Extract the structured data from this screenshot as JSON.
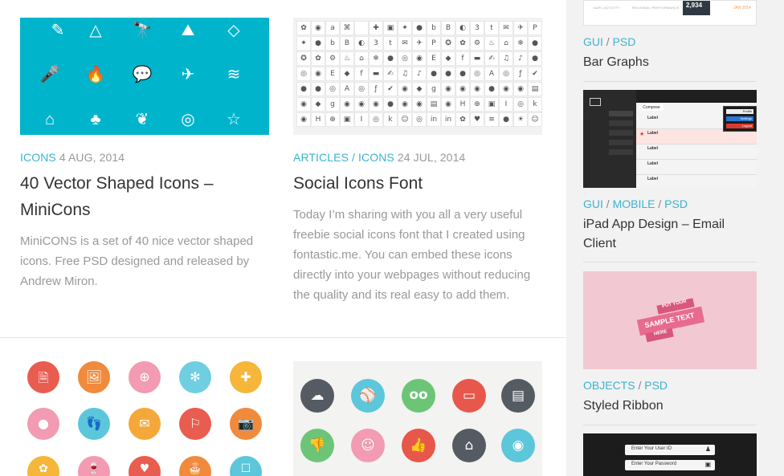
{
  "posts": [
    {
      "categories": [
        "ICONS"
      ],
      "date": "4 AUG, 2014",
      "title": "40 Vector Shaped Icons – MiniCons",
      "excerpt": "MiniCONS is a set of 40 nice vector shaped icons. Free PSD designed and released by Andrew Miron."
    },
    {
      "categories": [
        "ARTICLES",
        "ICONS"
      ],
      "date": "24 JUL, 2014",
      "title": "Social Icons Font",
      "excerpt": "Today I’m sharing with you all a very useful freebie social icons font that I created using fontastic.me. You can embed these icons directly into your webpages without reducing the quality and its real easy to add them."
    }
  ],
  "minicons": [
    "✎",
    "△",
    "🔭",
    "⛰",
    "◇",
    "🎤",
    "🔥",
    "💬",
    "✈",
    "≋",
    "⌂",
    "♣",
    "❦",
    "◎",
    "☆"
  ],
  "social_glyphs": [
    "✿",
    "◉",
    "a",
    "⌘",
    "",
    "✚",
    "▣",
    "✦",
    "●",
    "b",
    "B",
    "◐",
    "3",
    "t",
    "✉",
    "✈",
    "P",
    "✪",
    "✿",
    "⚙",
    "♨",
    "⌂",
    "❄",
    "●",
    "◎",
    "◉",
    "E",
    "◆",
    "f",
    "▬",
    "✍",
    "♫",
    "♪",
    "●",
    "●",
    "●",
    "◎",
    "A",
    "◎",
    "ƒ",
    "✔",
    "◉",
    "◆",
    "g",
    "◉",
    "◉",
    "◉",
    "●",
    "◉",
    "◉",
    "▤",
    "◉",
    "H",
    "⊕",
    "▣",
    "I",
    "◎",
    "k",
    "☺",
    "◎",
    "in",
    "in",
    "✿",
    "♥",
    "≡",
    "●",
    "☀",
    "☺"
  ],
  "flat_icons_row1": [
    "🗎",
    "🖼",
    "⊕",
    "✻",
    "✚"
  ],
  "flat_icons_row2": [
    "●",
    "👣",
    "✉",
    "⚐",
    "📷"
  ],
  "flat_icons_row3": [
    "✿",
    "🍷",
    "♥",
    "🎂",
    "☐"
  ],
  "flat2_row1": [
    "☁",
    "⚾",
    "oo",
    "▭",
    "▤"
  ],
  "flat2_row2": [
    "👎",
    "☺",
    "👍",
    "⌂",
    "◉"
  ],
  "sidebar": {
    "top_card": {
      "label_a": "AAPL ACTIVITY",
      "label_b": "REGIONAL PERFORMANCE",
      "stat": "2,934",
      "date": "JAN 2014"
    },
    "items": [
      {
        "categories": [
          "GUI",
          "PSD"
        ],
        "title": "Bar Graphs"
      },
      {
        "categories": [
          "GUI",
          "MOBILE",
          "PSD"
        ],
        "title": "iPad App Design – Email Client"
      },
      {
        "categories": [
          "OBJECTS",
          "PSD"
        ],
        "title": "Styled Ribbon"
      }
    ],
    "ribbon": {
      "line1": "PUT YOUR",
      "line2": "SAMPLE TEXT",
      "line3": "HERE"
    },
    "ipad": {
      "compose": "Compose",
      "popup": [
        "Profile",
        "Settings",
        "Logout"
      ],
      "label": "Label"
    },
    "login": {
      "user_id": "Enter Your User ID",
      "password": "Enter Your Password"
    }
  },
  "colors": {
    "accent": "#3bb3cf",
    "teal_thumb": "#00b4cc",
    "ribbon_bg": "#f2c9d3",
    "ribbon": "#e86b8f",
    "title": "#333333",
    "muted": "#999999"
  }
}
